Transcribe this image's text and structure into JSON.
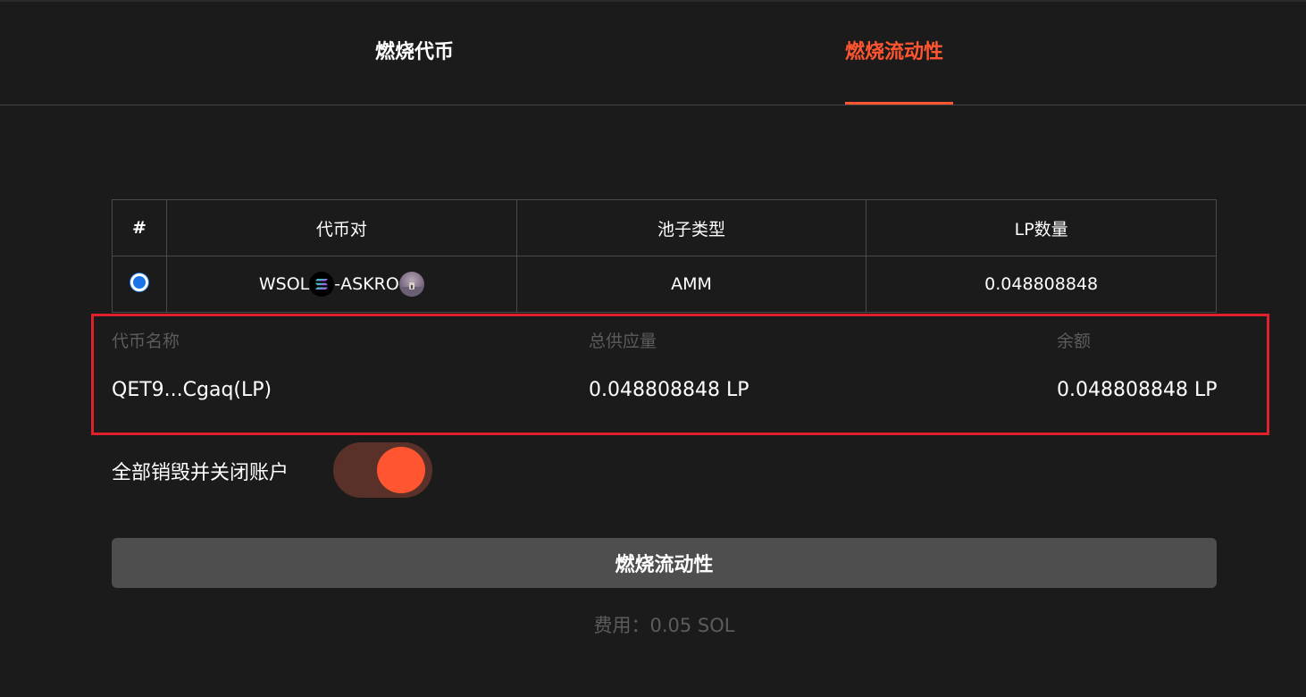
{
  "tabs": {
    "burn_token": "燃烧代币",
    "burn_liquidity": "燃烧流动性",
    "active": "burn_liquidity"
  },
  "table": {
    "headers": [
      "#",
      "代币对",
      "池子类型",
      "LP数量"
    ],
    "rows": [
      {
        "selected": true,
        "pair_base": "WSOL",
        "pair_separator": "- ",
        "pair_quote": "ASKRO",
        "pool_type": "AMM",
        "lp_amount": "0.048808848"
      }
    ]
  },
  "token_info": {
    "name_label": "代币名称",
    "supply_label": "总供应量",
    "balance_label": "余额",
    "name_value": "QET9...Cgaq(LP)",
    "supply_value": "0.048808848 LP",
    "balance_value": "0.048808848 LP"
  },
  "toggle": {
    "label": "全部销毁并关闭账户",
    "on": true
  },
  "burn_button": {
    "label": "燃烧流动性"
  },
  "fee": {
    "text": "费用：0.05 SOL"
  },
  "colors": {
    "accent": "#ff5530",
    "background": "#1b1b1b",
    "highlight_border": "#e0202a",
    "muted_text": "#5c5c5c",
    "button_bg": "#4e4e4e"
  },
  "icons": {
    "sol": "solana-icon",
    "askro": "askro-token-icon"
  }
}
